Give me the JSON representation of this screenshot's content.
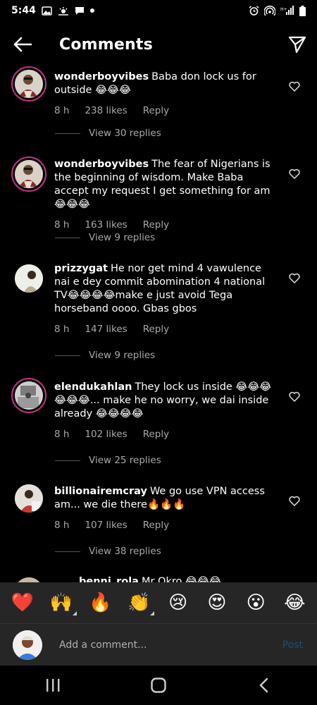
{
  "status_bar": {
    "time": "5:44",
    "icons": [
      "gallery-icon",
      "weather-icon",
      "message-icon",
      "dot-icon",
      "alarm-icon",
      "hotspot-icon",
      "signal-icon",
      "battery-icon"
    ]
  },
  "header": {
    "title": "Comments",
    "back_icon": "arrow-left-icon",
    "share_icon": "send-icon"
  },
  "comments": [
    {
      "username": "wonderboyvibes",
      "text": "Baba don lock us for outside 😂😂😂",
      "time": "8 h",
      "likes": "238 likes",
      "reply": "Reply",
      "view_replies": "View 30 replies"
    },
    {
      "username": "wonderboyvibes",
      "text": "The fear of Nigerians is the beginning of wisdom. Make Baba accept my request I get something for am 😂😂😂",
      "time": "8 h",
      "likes": "163 likes",
      "reply": "Reply",
      "view_replies": "View 9 replies"
    },
    {
      "username": "prizzygat",
      "text": "He nor get mind 4 vawulence nai e dey commit abomination 4 national TV😂😂😂😂make e just avoid Tega horseband oooo. Gbas gbos",
      "time": "8 h",
      "likes": "147 likes",
      "reply": "Reply",
      "view_replies": "View 9 replies"
    },
    {
      "username": "elendukahlan",
      "text": "They lock us inside 😂😂😂😂😂😂... make he no worry, we dai inside already 😂😂😂😂",
      "time": "8 h",
      "likes": "102 likes",
      "reply": "Reply",
      "view_replies": "View 25 replies"
    },
    {
      "username": "billionairemcray",
      "text": "We go use VPN access am... we die there🔥🔥🔥",
      "time": "8 h",
      "likes": "107 likes",
      "reply": "Reply",
      "view_replies": "View 38 replies"
    },
    {
      "username": "benni_rola",
      "text": "Mr Okro 😂😂😂",
      "time": "",
      "likes": "",
      "reply": "",
      "view_replies": ""
    }
  ],
  "emoji_bar": [
    "❤️",
    "🙌",
    "🔥",
    "👏",
    "😢",
    "😍",
    "😮",
    "😂"
  ],
  "composer": {
    "placeholder": "Add a comment...",
    "post_label": "Post"
  },
  "nav_bar": [
    "recents-icon",
    "home-icon",
    "back-icon"
  ]
}
